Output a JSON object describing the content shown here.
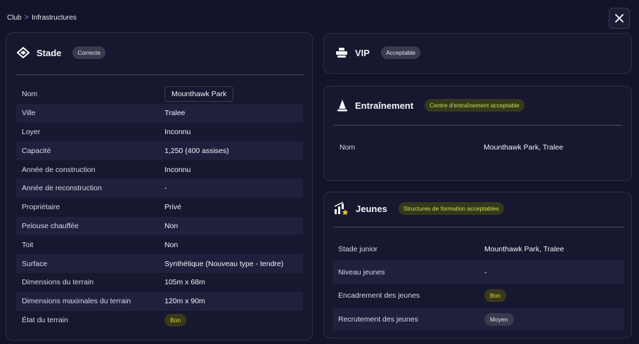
{
  "breadcrumb": {
    "root": "Club",
    "separator": ">",
    "current": "Infrastructures"
  },
  "close_icon": "close-icon",
  "stade": {
    "title": "Stade",
    "icon": "stadium-icon",
    "badge": "Correcte",
    "rows": [
      {
        "label": "Nom",
        "value": "Mounthawk Park",
        "type": "input"
      },
      {
        "label": "Ville",
        "value": "Tralee"
      },
      {
        "label": "Loyer",
        "value": "Inconnu"
      },
      {
        "label": "Capacité",
        "value": "1,250 (400 assises)"
      },
      {
        "label": "Année de construction",
        "value": "Inconnu"
      },
      {
        "label": "Année de reconstruction",
        "value": "-"
      },
      {
        "label": "Propriétaire",
        "value": "Privé"
      },
      {
        "label": "Pelouse chauffée",
        "value": "Non"
      },
      {
        "label": "Toit",
        "value": "Non"
      },
      {
        "label": "Surface",
        "value": "Synthétique (Nouveau type - tendre)"
      },
      {
        "label": "Dimensions du terrain",
        "value": "105m x 68m"
      },
      {
        "label": "Dimensions maximales du terrain",
        "value": "120m x 90m"
      },
      {
        "label": "État du terrain",
        "value": "Bon",
        "type": "pill-bon"
      }
    ]
  },
  "vip": {
    "title": "VIP",
    "icon": "vip-seat-icon",
    "badge": "Acceptable"
  },
  "entrainement": {
    "title": "Entraînement",
    "icon": "training-cone-icon",
    "badge": "Centre d'entraînement acceptable",
    "rows": [
      {
        "label": "Nom",
        "value": "Mounthawk Park, Tralee"
      }
    ]
  },
  "jeunes": {
    "title": "Jeunes",
    "icon": "youth-chart-star-icon",
    "badge": "Structures de formation acceptables",
    "rows": [
      {
        "label": "Stade junior",
        "value": "Mounthawk Park, Tralee"
      },
      {
        "label": "Niveau jeunes",
        "value": "-"
      },
      {
        "label": "Encadrement des jeunes",
        "value": "Bon",
        "type": "pill-bon"
      },
      {
        "label": "Recrutement des jeunes",
        "value": "Moyen",
        "type": "pill-moyen"
      }
    ]
  }
}
